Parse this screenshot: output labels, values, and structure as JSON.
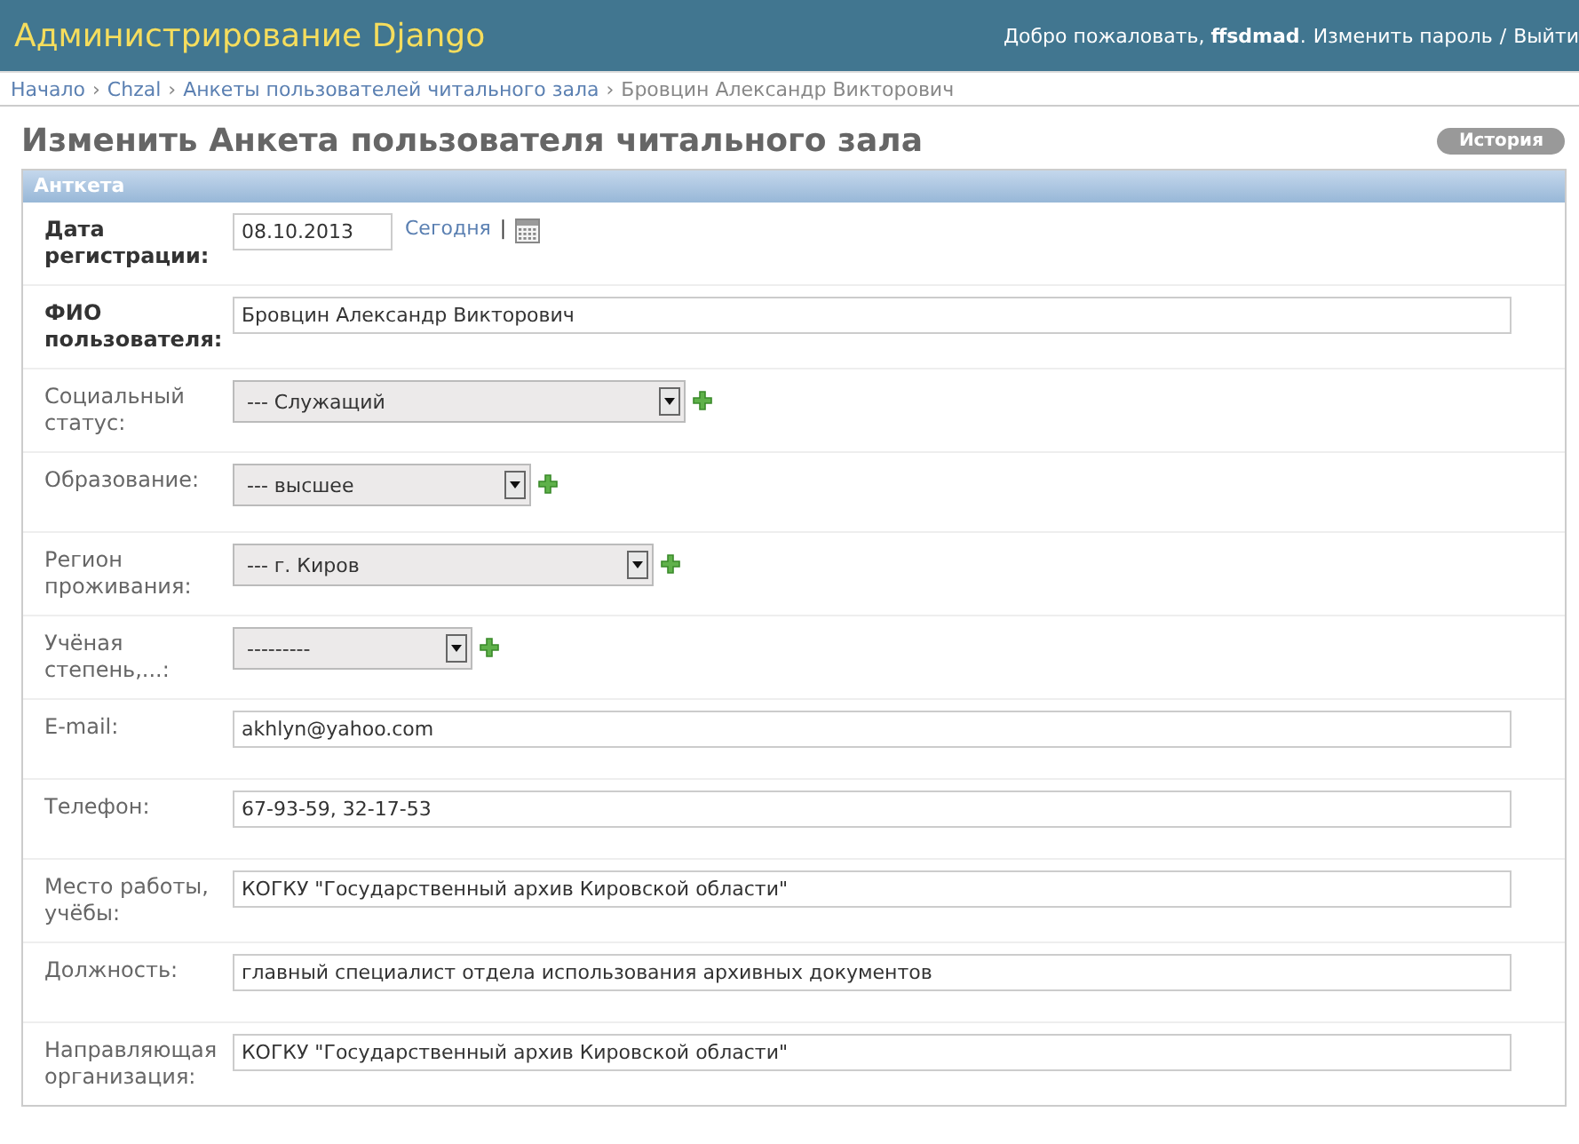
{
  "header": {
    "title": "Администрирование Django",
    "welcome": "Добро пожаловать, **ffsdmad**.",
    "links": [
      "Изменить пароль",
      "Выйти"
    ],
    "separator": "/"
  },
  "breadcrumbs": {
    "links": [
      "Начало",
      "Chzal",
      "Анкеты пользователей читального зала"
    ],
    "separator": "›",
    "current": "Бровцин Александр Викторович"
  },
  "page_title": "Изменить Анкета пользователя читального зала",
  "history_button": "История",
  "fieldset": {
    "title": "Анткета",
    "fields": [
      {
        "label": "Дата регистрации:",
        "required": true,
        "kind": "date",
        "value": "08.10.2013",
        "today_link": "Сегодня",
        "separator": "|"
      },
      {
        "label": "ФИО пользователя:",
        "required": true,
        "kind": "text",
        "value": "Бровцин Александр Викторович"
      },
      {
        "label": "Социальный статус:",
        "required": false,
        "kind": "select",
        "value": "--- Служащий",
        "add": true
      },
      {
        "label": "Образование:",
        "required": false,
        "kind": "select",
        "value": "--- высшее",
        "add": true
      },
      {
        "label": "Регион проживания:",
        "required": false,
        "kind": "select",
        "value": "--- г. Киров",
        "add": true
      },
      {
        "label": "Учёная степень,...:",
        "required": false,
        "kind": "select",
        "value": "---------",
        "add": true
      },
      {
        "label": "E-mail:",
        "required": false,
        "kind": "text",
        "value": "akhlyn@yahoo.com"
      },
      {
        "label": "Телефон:",
        "required": false,
        "kind": "text",
        "value": "67-93-59, 32-17-53"
      },
      {
        "label": "Место работы, учёбы:",
        "required": false,
        "kind": "text",
        "value": "КОГКУ \"Государственный архив Кировской области\""
      },
      {
        "label": "Должность:",
        "required": false,
        "kind": "text",
        "value": "главный специалист отдела использования архивных документов"
      },
      {
        "label": "Направляющая организация:",
        "required": false,
        "kind": "text",
        "value": "КОГКУ \"Государственный архив Кировской области\""
      }
    ]
  }
}
